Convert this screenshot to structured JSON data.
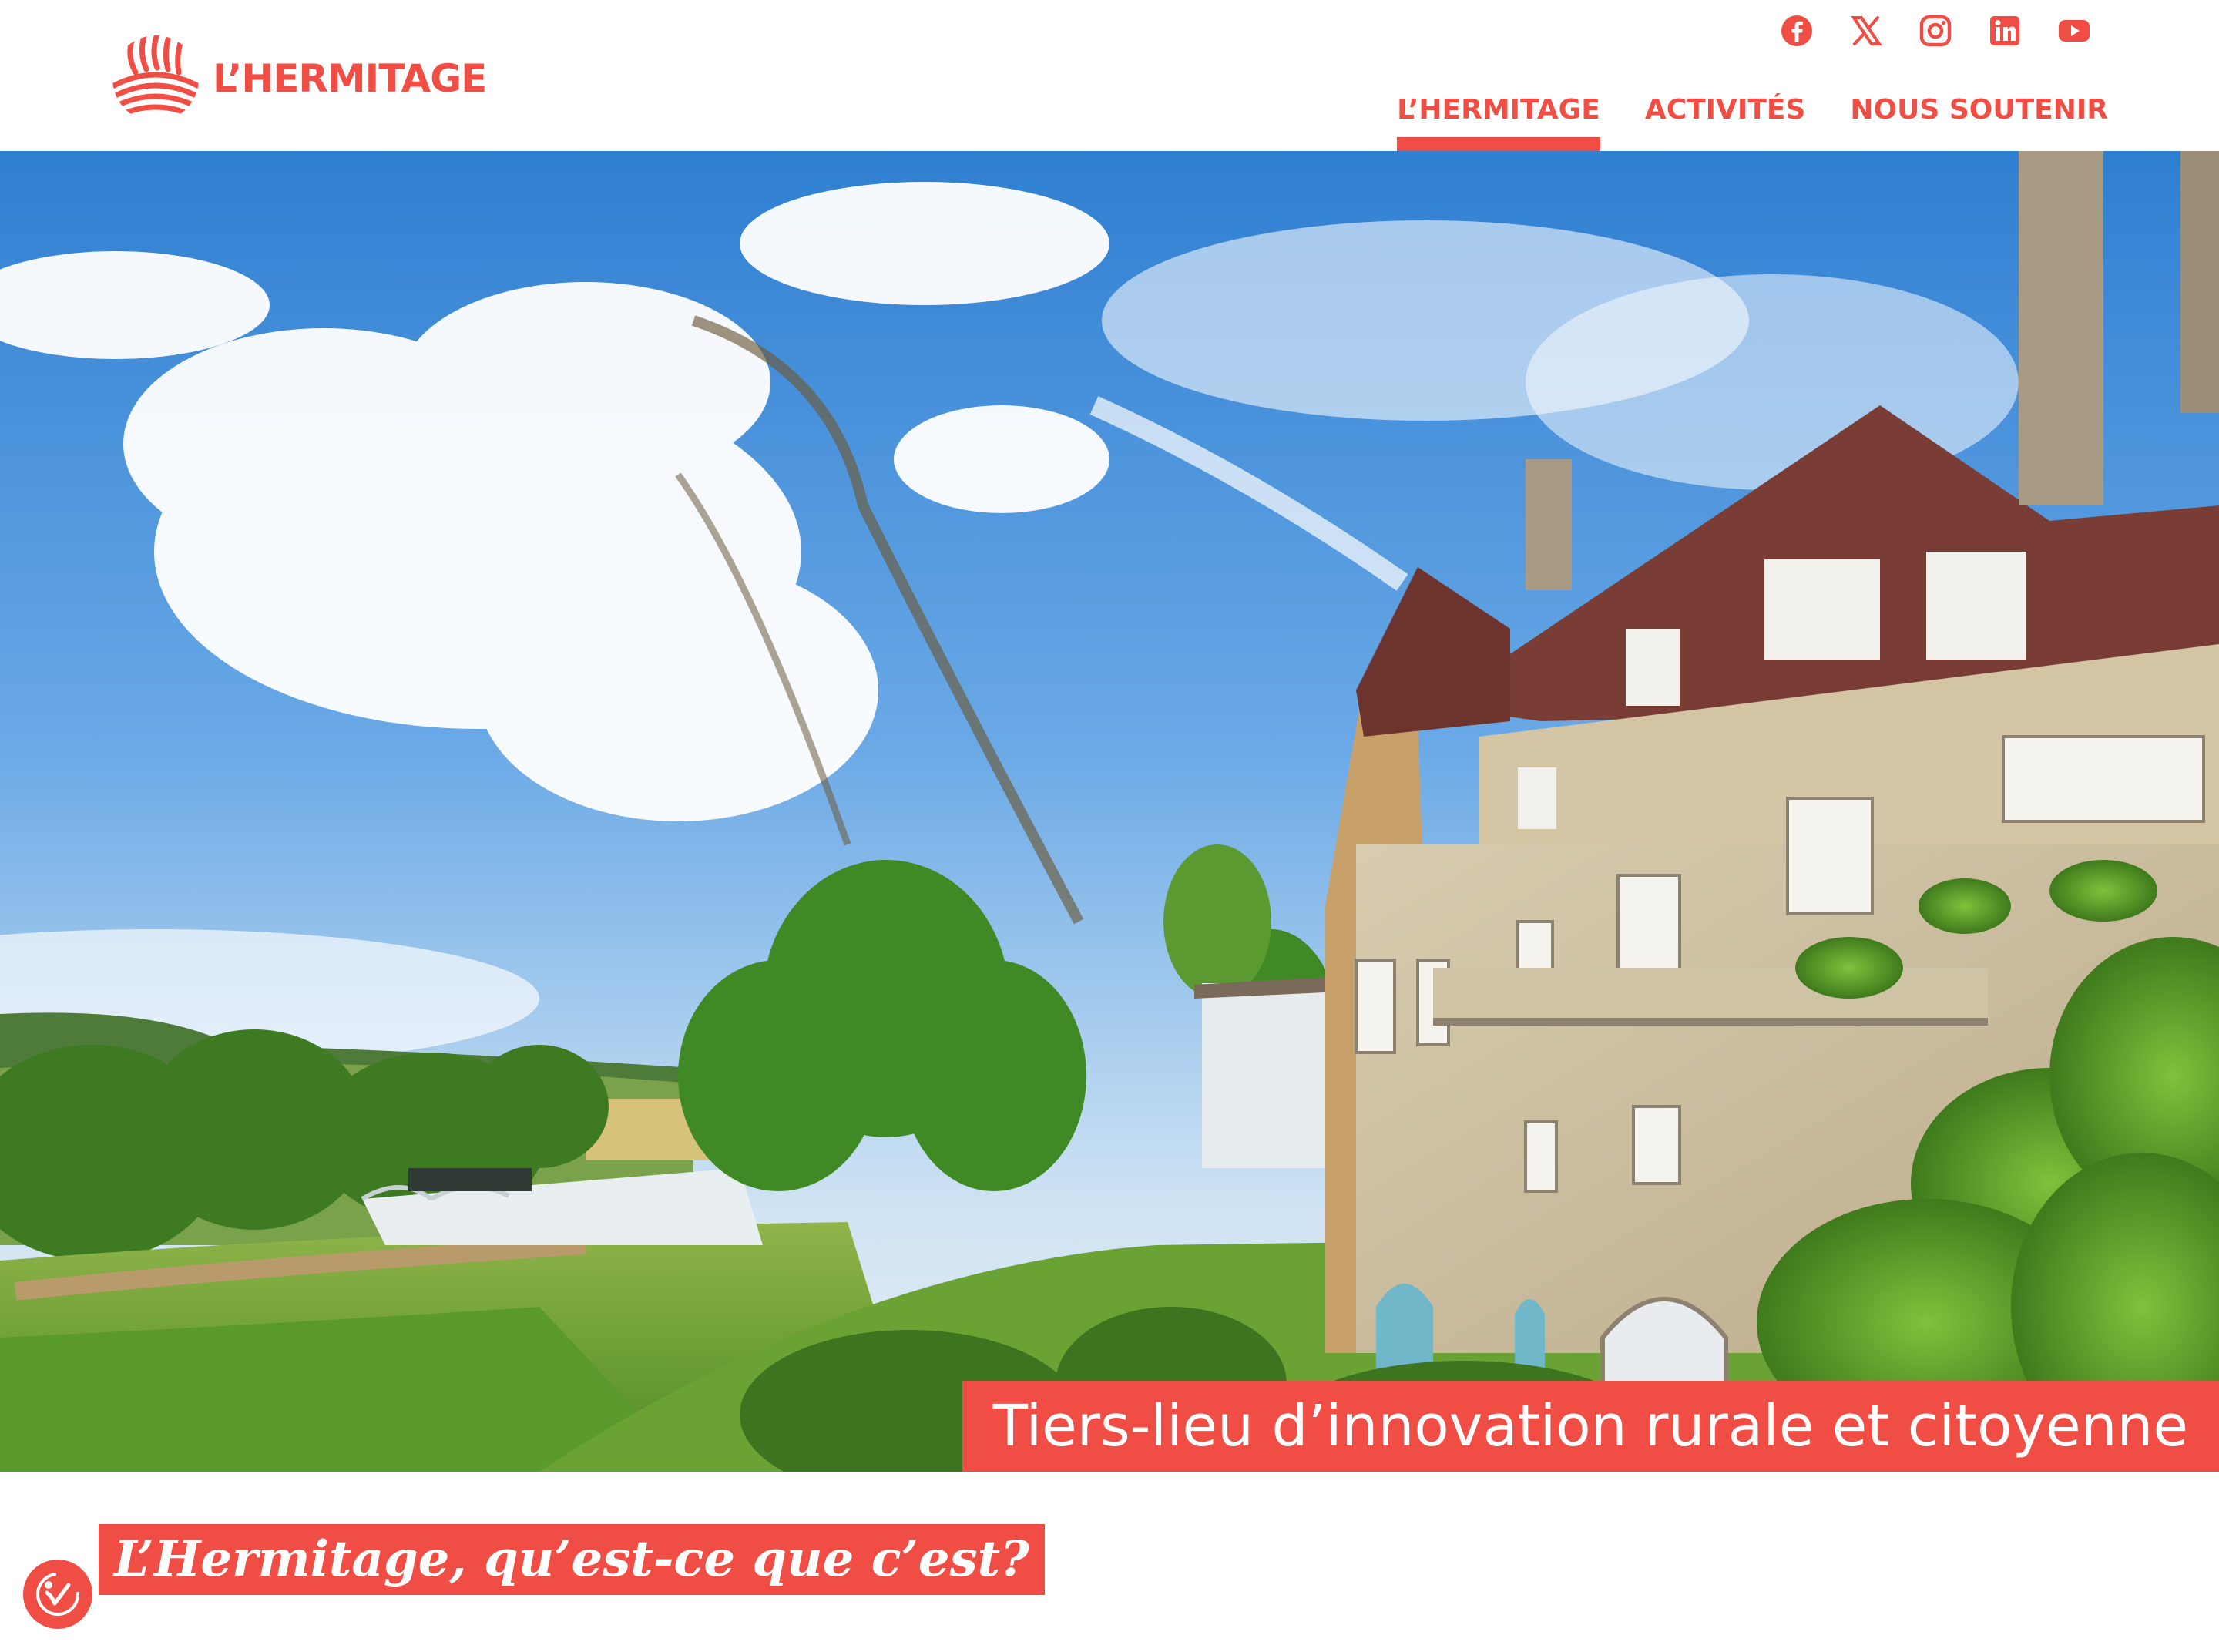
{
  "brand": {
    "name": "L’HERMITAGE",
    "accent_color": "#f04e45"
  },
  "social": [
    {
      "name": "facebook-icon"
    },
    {
      "name": "x-twitter-icon"
    },
    {
      "name": "instagram-icon"
    },
    {
      "name": "linkedin-icon"
    },
    {
      "name": "youtube-icon"
    }
  ],
  "nav": {
    "items": [
      {
        "label": "L’HERMITAGE",
        "active": true
      },
      {
        "label": "ACTIVITÉS",
        "active": false
      },
      {
        "label": "NOUS SOUTENIR",
        "active": false
      }
    ]
  },
  "hero": {
    "tagline": "Tiers-lieu d’innovation rurale et citoyenne"
  },
  "section": {
    "title": "L’Hermitage, qu’est-ce que c’est?"
  },
  "accessibility": {
    "icon": "accessibility-icon"
  }
}
